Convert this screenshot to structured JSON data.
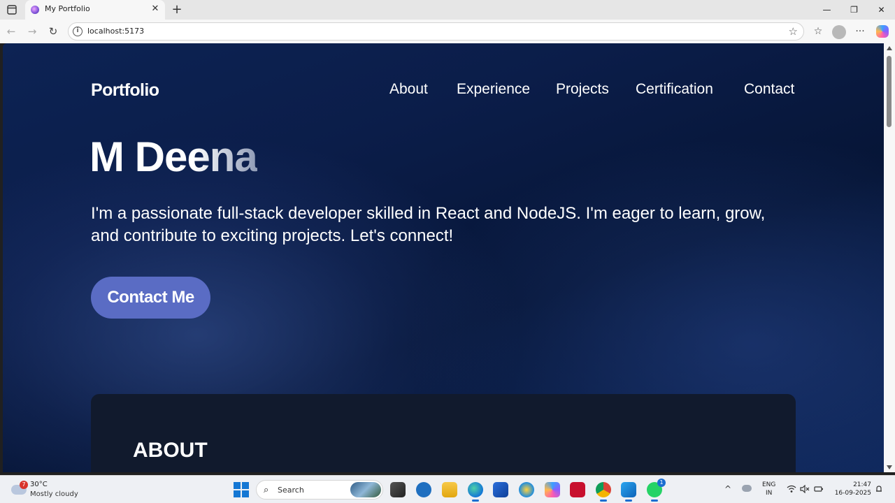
{
  "browser": {
    "tab_title": "My Portfolio",
    "tab_close": "✕",
    "new_tab": "+",
    "url": "localhost:5173",
    "info_glyph": "i",
    "star_glyph": "☆",
    "back_glyph": "←",
    "forward_glyph": "→",
    "reload_glyph": "↻",
    "favorites_glyph": "☆",
    "more_glyph": "···",
    "minimize_glyph": "—",
    "restore_glyph": "❐",
    "close_glyph": "✕"
  },
  "site": {
    "brand": "Portfolio",
    "nav": [
      "About",
      "Experience",
      "Projects",
      "Certification",
      "Contact"
    ],
    "hero_name": "M Deena",
    "hero_text": "I'm a passionate full-stack developer skilled in React and NodeJS. I'm eager to learn, grow, and contribute to exciting projects. Let's connect!",
    "cta": "Contact Me",
    "about_heading": "ABOUT"
  },
  "taskbar": {
    "weather_badge": "7",
    "temperature": "30°C",
    "condition": "Mostly cloudy",
    "search_label": "Search",
    "search_glyph": "⌕",
    "tray_chevron": "^",
    "lang_line1": "ENG",
    "lang_line2": "IN",
    "time": "21:47",
    "date": "16-09-2025",
    "whatsapp_badge": "1"
  },
  "colors": {
    "page_bg": "#0b1d49",
    "button_bg": "#5a6cc4",
    "card_bg": "#111a2d",
    "accent_blue": "#1477d4"
  }
}
